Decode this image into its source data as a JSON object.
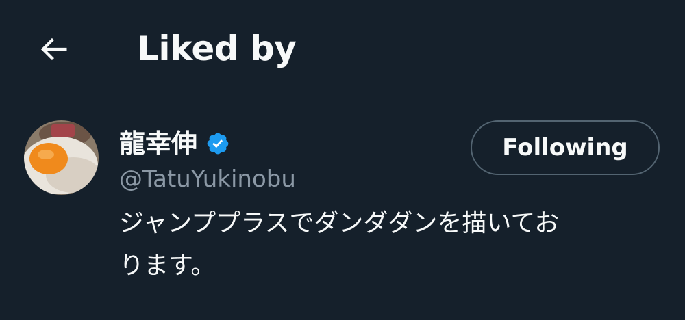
{
  "header": {
    "title": "Liked by",
    "back_icon": "arrow-left-icon"
  },
  "user": {
    "display_name": "龍幸伸",
    "verified_icon": "verified-badge-icon",
    "verified_color": "#1d9bf0",
    "handle": "@TatuYukinobu",
    "bio_line1": "ジャンププラスでダンダダンを描いてお",
    "bio_line2": "ります。",
    "follow_label": "Following",
    "avatar_icon": "fried-egg-avatar"
  },
  "colors": {
    "background": "#15202b",
    "text": "#f7f9f9",
    "secondary_text": "#8b98a5",
    "border": "#38444d"
  }
}
